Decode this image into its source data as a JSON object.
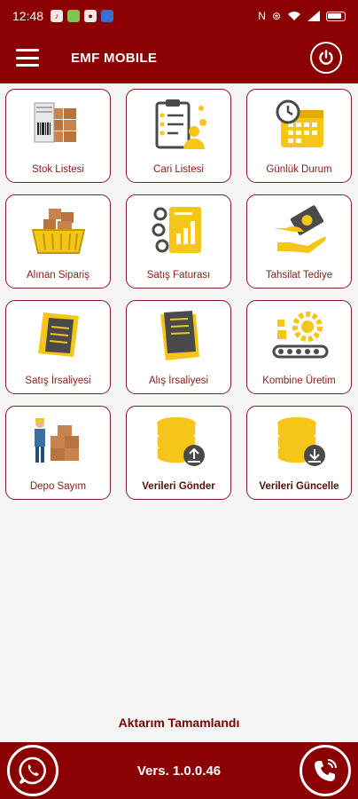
{
  "status_bar": {
    "time": "12:48",
    "network_text": "N",
    "icons": [
      "tiktok-icon",
      "messages-icon",
      "game-icon",
      "vpn-icon",
      "nfc-icon",
      "vibrate-icon",
      "wifi-icon",
      "signal-icon",
      "battery-icon"
    ]
  },
  "app_bar": {
    "title": "EMF MOBILE",
    "menu_icon": "hamburger-menu-icon",
    "power_icon": "power-icon"
  },
  "tiles": [
    {
      "label": "Stok Listesi",
      "icon": "warehouse-barcode-icon"
    },
    {
      "label": "Cari Listesi",
      "icon": "clipboard-customers-icon"
    },
    {
      "label": "Günlük Durum",
      "icon": "calendar-clock-icon"
    },
    {
      "label": "Alınan Sipariş",
      "icon": "basket-boxes-icon"
    },
    {
      "label": "Satış Faturası",
      "icon": "invoice-chart-icon"
    },
    {
      "label": "Tahsilat Tediye",
      "icon": "cash-hand-icon"
    },
    {
      "label": "Satış İrsaliyesi",
      "icon": "document-icon"
    },
    {
      "label": "Alış İrsaliyesi",
      "icon": "document-icon"
    },
    {
      "label": "Kombine Üretim",
      "icon": "conveyor-gear-icon"
    },
    {
      "label": "Depo Sayım",
      "icon": "worker-boxes-icon"
    },
    {
      "label": "Verileri Gönder",
      "icon": "database-upload-icon"
    },
    {
      "label": "Verileri Güncelle",
      "icon": "database-download-icon"
    }
  ],
  "footer": {
    "message": "Aktarım Tamamlandı",
    "version": "Vers. 1.0.0.46",
    "left_icon": "whatsapp-icon",
    "right_icon": "phone-call-icon"
  },
  "colors": {
    "brand": "#8b0000",
    "accent_yellow": "#f5c518",
    "icon_gray": "#4a4a4a",
    "box_brown": "#c8834f"
  }
}
